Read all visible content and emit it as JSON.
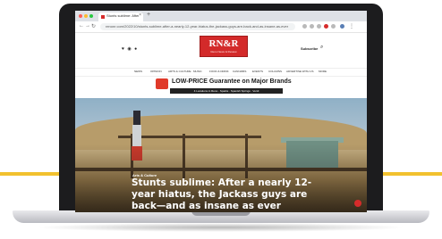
{
  "browser": {
    "tab_title": "Stunts sublime: After a nearly 12-",
    "url": "renonr.com/2022/10/stunts-sublime-after-a-nearly-12-year-hiatus-the-jackass-guys-are-back-and-as-insane-as-ever"
  },
  "site": {
    "logo_text": "RN&R",
    "logo_tagline": "Reno News & Review",
    "social": "♥ ◉ ●",
    "subscribe_label": "Subscribe",
    "nav_items": [
      "NEWS",
      "OPINION",
      "ARTS & CULTURE",
      "MUSIC",
      "FOOD & DRINK",
      "CANNABIS",
      "EVENTS",
      "COLUMNS",
      "ADVERTISE WITH US",
      "MORE"
    ]
  },
  "ad": {
    "headline": "LOW-PRICE Guarantee on Major Brands",
    "subline": "4 Locations in Reno · Sparks · Spanish Springs · Verdi"
  },
  "article": {
    "category": "Arts & Culture",
    "headline": "Stunts sublime: After a nearly 12-year hiatus, the Jackass guys are back—and as insane as ever"
  },
  "colors": {
    "accent": "#d32a2a",
    "yellow_rule": "#f2c12e"
  }
}
